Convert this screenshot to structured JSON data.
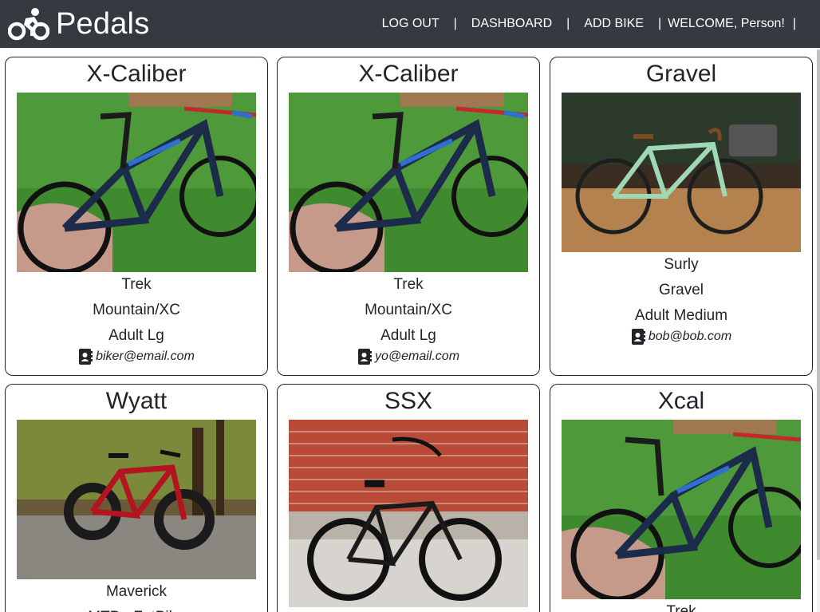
{
  "app": {
    "name": "Pedals"
  },
  "nav": {
    "logout": "LOG OUT",
    "dashboard": "DASHBOARD",
    "add_bike": "ADD BIKE",
    "welcome": "WELCOME, Person!",
    "separator": "|"
  },
  "colors": {
    "navbar": "#343a40",
    "text": "#212529"
  },
  "bikes": [
    {
      "title": "X-Caliber",
      "brand": "Trek",
      "type": "Mountain/XC",
      "size": "Adult Lg",
      "email": "biker@email.com",
      "photo_icon": "mountain-bike-photo"
    },
    {
      "title": "X-Caliber",
      "brand": "Trek",
      "type": "Mountain/XC",
      "size": "Adult Lg",
      "email": "yo@email.com",
      "photo_icon": "mountain-bike-photo"
    },
    {
      "title": "Gravel",
      "brand": "Surly",
      "type": "Gravel",
      "size": "Adult Medium",
      "email": "bob@bob.com",
      "photo_icon": "gravel-bike-photo"
    },
    {
      "title": "Wyatt",
      "brand": "Maverick",
      "type": "MTB - FatBike",
      "photo_icon": "fat-bike-photo"
    },
    {
      "title": "SSX",
      "photo_icon": "cruiser-bike-photo"
    },
    {
      "title": "Xcal",
      "brand": "Trek",
      "photo_icon": "mountain-bike-photo"
    }
  ]
}
